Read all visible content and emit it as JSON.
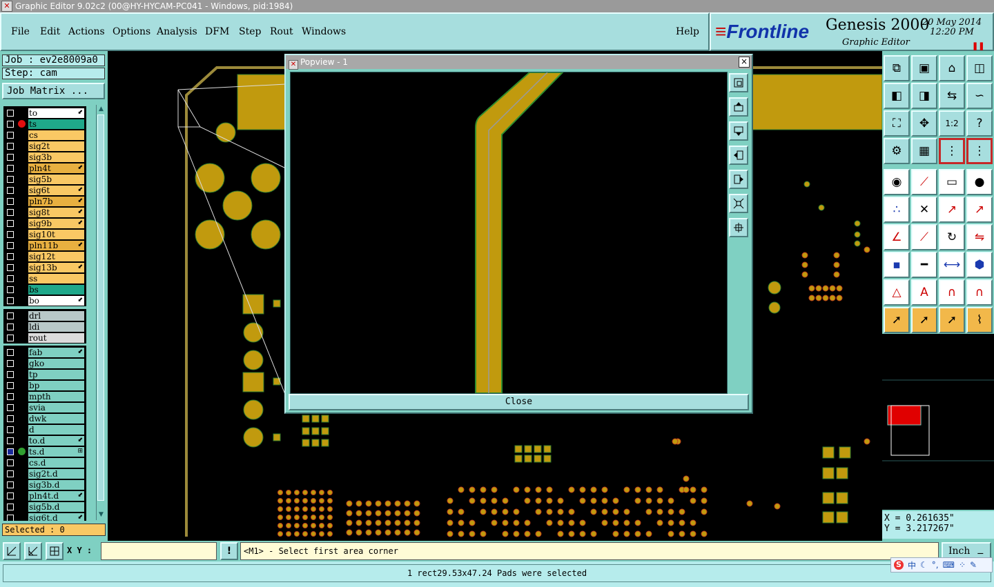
{
  "window": {
    "title": "Graphic Editor 9.02c2 (00@HY-HYCAM-PC041 - Windows, pid:1984)"
  },
  "menu": [
    "File",
    "Edit",
    "Actions",
    "Options",
    "Analysis",
    "DFM",
    "Step",
    "Rout",
    "Windows"
  ],
  "help_label": "Help",
  "brand": {
    "logo": "Frontline",
    "product": "Genesis 2000",
    "subtitle": "Graphic Editor",
    "date": "20 May 2014",
    "time": "12:20 PM"
  },
  "job": {
    "job_label": "Job : ev2e8009a0",
    "step_label": "Step: cam",
    "matrix_button": "Job Matrix ..."
  },
  "layers_group1": [
    {
      "name": "to",
      "color": "#ffffff",
      "flag": "⬋"
    },
    {
      "name": "ts",
      "color": "#1fa88a",
      "dot": "#e01010"
    },
    {
      "name": "cs",
      "color": "#f9c864"
    },
    {
      "name": "sig2t",
      "color": "#f9c864"
    },
    {
      "name": "sig3b",
      "color": "#f9c864"
    },
    {
      "name": "pln4t",
      "color": "#e8b040",
      "flag": "⬋"
    },
    {
      "name": "sig5b",
      "color": "#f9c864"
    },
    {
      "name": "sig6t",
      "color": "#f9c864",
      "flag": "⬋"
    },
    {
      "name": "pln7b",
      "color": "#e8b040",
      "flag": "⬋"
    },
    {
      "name": "sig8t",
      "color": "#f9c864",
      "flag": "⬋"
    },
    {
      "name": "sig9b",
      "color": "#f9c864",
      "flag": "⬋"
    },
    {
      "name": "sig10t",
      "color": "#f9c864"
    },
    {
      "name": "pln11b",
      "color": "#e8b040",
      "flag": "⬋"
    },
    {
      "name": "sig12t",
      "color": "#f9c864"
    },
    {
      "name": "sig13b",
      "color": "#f9c864",
      "flag": "⬋"
    },
    {
      "name": "ss",
      "color": "#f9c864"
    },
    {
      "name": "bs",
      "color": "#1fa88a"
    },
    {
      "name": "bo",
      "color": "#ffffff",
      "flag": "⬋"
    }
  ],
  "layers_group2": [
    {
      "name": "drl",
      "color": "#b8c8c8"
    },
    {
      "name": "ldi",
      "color": "#b8c8c8"
    },
    {
      "name": "rout",
      "color": "#dcdcdc"
    }
  ],
  "layers_group3": [
    {
      "name": "fab",
      "color": "#7fd0c2",
      "flag": "⬋"
    },
    {
      "name": "gko",
      "color": "#7fd0c2"
    },
    {
      "name": "tp",
      "color": "#7fd0c2"
    },
    {
      "name": "bp",
      "color": "#7fd0c2"
    },
    {
      "name": "mpth",
      "color": "#7fd0c2"
    },
    {
      "name": "svia",
      "color": "#7fd0c2"
    },
    {
      "name": "dwk",
      "color": "#7fd0c2"
    },
    {
      "name": "d",
      "color": "#7fd0c2"
    },
    {
      "name": "to.d",
      "color": "#7fd0c2",
      "flag": "⬋"
    },
    {
      "name": "ts.d",
      "color": "#7fd0c2",
      "dot": "#30a030",
      "flag": "⊞",
      "checked": true
    },
    {
      "name": "cs.d",
      "color": "#7fd0c2"
    },
    {
      "name": "sig2t.d",
      "color": "#7fd0c2"
    },
    {
      "name": "sig3b.d",
      "color": "#7fd0c2"
    },
    {
      "name": "pln4t.d",
      "color": "#7fd0c2",
      "flag": "⬋"
    },
    {
      "name": "sig5b.d",
      "color": "#7fd0c2"
    },
    {
      "name": "sig6t.d",
      "color": "#7fd0c2",
      "flag": "⬋"
    }
  ],
  "selected_label": "Selected : 0",
  "popview": {
    "title": "Popview - 1",
    "close_x": "×",
    "close_button": "Close"
  },
  "coords": {
    "x": "X = 0.261635\"",
    "y": "Y = 3.217267\""
  },
  "bottom": {
    "xy_label": "X Y :",
    "xy_value": "",
    "bang": "!",
    "prompt": "<M1> - Select first area corner",
    "unit": "Inch"
  },
  "status_message": "1 rect29.53x47.24 Pads were selected",
  "ime": {
    "s": "S",
    "zh": "中"
  },
  "colors": {
    "panel": "#7fd0c2",
    "button": "#a7dede",
    "copper": "#c19a0e",
    "layer_orange": "#f9c864",
    "layer_green": "#1fa88a"
  }
}
